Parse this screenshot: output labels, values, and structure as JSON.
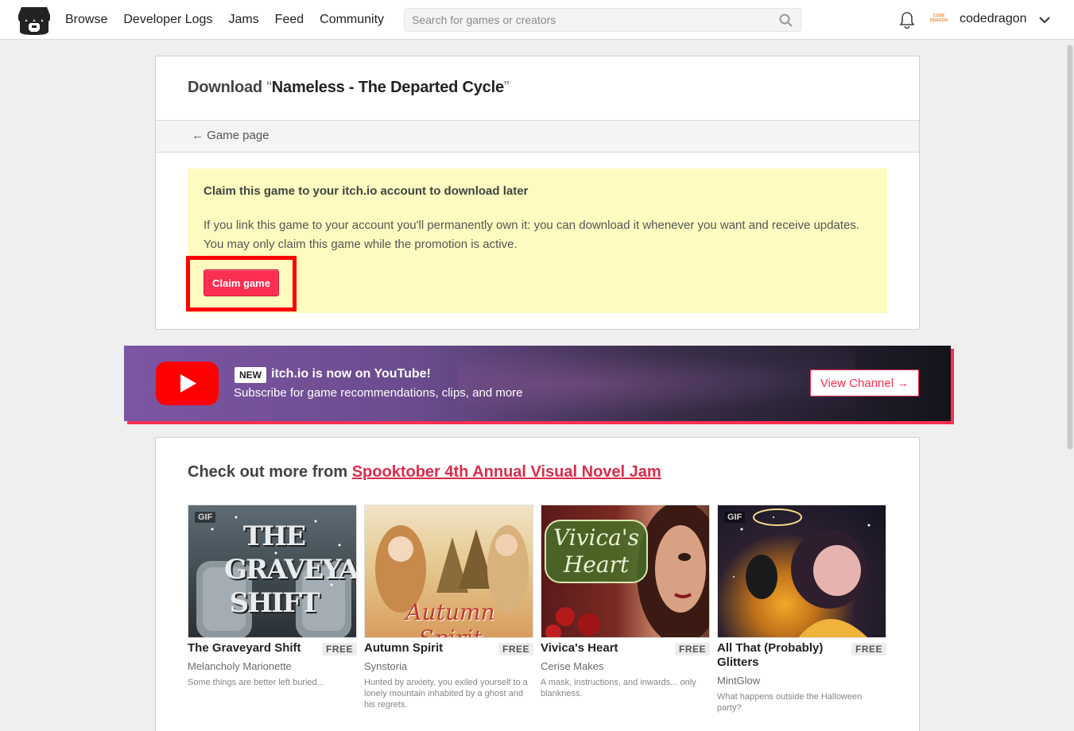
{
  "header": {
    "nav": [
      "Browse",
      "Developer Logs",
      "Jams",
      "Feed",
      "Community"
    ],
    "search_placeholder": "Search for games or creators",
    "avatar_text": "CODE DRAGON",
    "username": "codedragon"
  },
  "download": {
    "prefix": "Download ",
    "open_quote": "“",
    "game_name": "Nameless - The Departed Cycle",
    "close_quote": "”",
    "back_link": "← Game page",
    "claim_title": "Claim this game to your itch.io account to download later",
    "claim_text": "If you link this game to your account you'll permanently own it: you can download it whenever you want and receive updates. You may only claim this game while the promotion is active.",
    "claim_button": "Claim game"
  },
  "youtube_banner": {
    "badge": "NEW",
    "title": "itch.io is now on YouTube!",
    "subtitle": "Subscribe for game recommendations, clips, and more",
    "button": "View Channel →"
  },
  "more": {
    "prefix": "Check out more from ",
    "jam_link": "Spooktober 4th Annual Visual Novel Jam",
    "games": [
      {
        "title": "The Graveyard Shift",
        "price": "FREE",
        "author": "Melancholy Marionette",
        "desc": "Some things are better left buried...",
        "gif": "GIF",
        "thumb_text": "THE GRAVEYARD SHIFT"
      },
      {
        "title": "Autumn Spirit",
        "price": "FREE",
        "author": "Synstoria",
        "desc": "Hunted by anxiety, you exiled yourself to a lonely mountain inhabited by a ghost and his regrets.",
        "gif": "",
        "thumb_text": "Autumn Spirit"
      },
      {
        "title": "Vivica's Heart",
        "price": "FREE",
        "author": "Cerise Makes",
        "desc": "A mask, instructions, and inwards... only blankness.",
        "gif": "",
        "thumb_text": "Vivica's Heart"
      },
      {
        "title": "All That (Probably) Glitters",
        "price": "FREE",
        "author": "MintGlow",
        "desc": "What happens outside the Halloween party?",
        "gif": "GIF",
        "thumb_text": ""
      }
    ]
  },
  "colors": {
    "accent": "#fa2f51",
    "claim_bg": "#fdfbc0",
    "highlight": "#ff0000"
  }
}
